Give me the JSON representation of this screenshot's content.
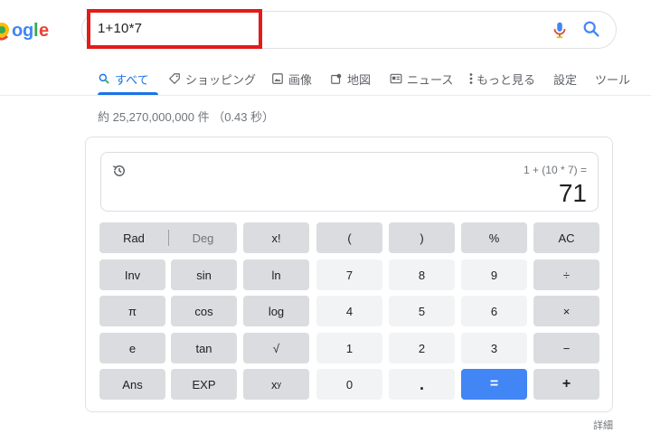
{
  "search": {
    "query": "1+10*7"
  },
  "tabs": [
    {
      "label": "すべて",
      "icon": "search-icon",
      "active": true
    },
    {
      "label": "ショッピング",
      "icon": "tag-icon",
      "active": false
    },
    {
      "label": "画像",
      "icon": "image-icon",
      "active": false
    },
    {
      "label": "地図",
      "icon": "map-icon",
      "active": false
    },
    {
      "label": "ニュース",
      "icon": "news-icon",
      "active": false
    },
    {
      "label": "もっと見る",
      "icon": "more-vert-icon",
      "active": false
    },
    {
      "label": "設定",
      "active": false
    },
    {
      "label": "ツール",
      "active": false
    }
  ],
  "result_stats": "約 25,270,000,000 件 （0.43 秒）",
  "calculator": {
    "expression": "1 + (10 * 7) =",
    "result": "71",
    "keys": {
      "rad": "Rad",
      "deg": "Deg",
      "fact": "x!",
      "lparen": "(",
      "rparen": ")",
      "percent": "%",
      "ac": "AC",
      "inv": "Inv",
      "sin": "sin",
      "ln": "ln",
      "k7": "7",
      "k8": "8",
      "k9": "9",
      "divide": "÷",
      "pi": "π",
      "cos": "cos",
      "log": "log",
      "k4": "4",
      "k5": "5",
      "k6": "6",
      "multiply": "×",
      "e": "e",
      "tan": "tan",
      "sqrt": "√",
      "k1": "1",
      "k2": "2",
      "k3": "3",
      "minus": "−",
      "ans": "Ans",
      "exp": "EXP",
      "pow_base": "x",
      "pow_exp": "y",
      "k0": "0",
      "dot": ".",
      "equals": "=",
      "plus": "+"
    }
  },
  "detail_link": "詳細",
  "colors": {
    "accent_blue": "#1a73e8",
    "highlight_red": "#e21b1b",
    "equals_button": "#4285f4"
  }
}
